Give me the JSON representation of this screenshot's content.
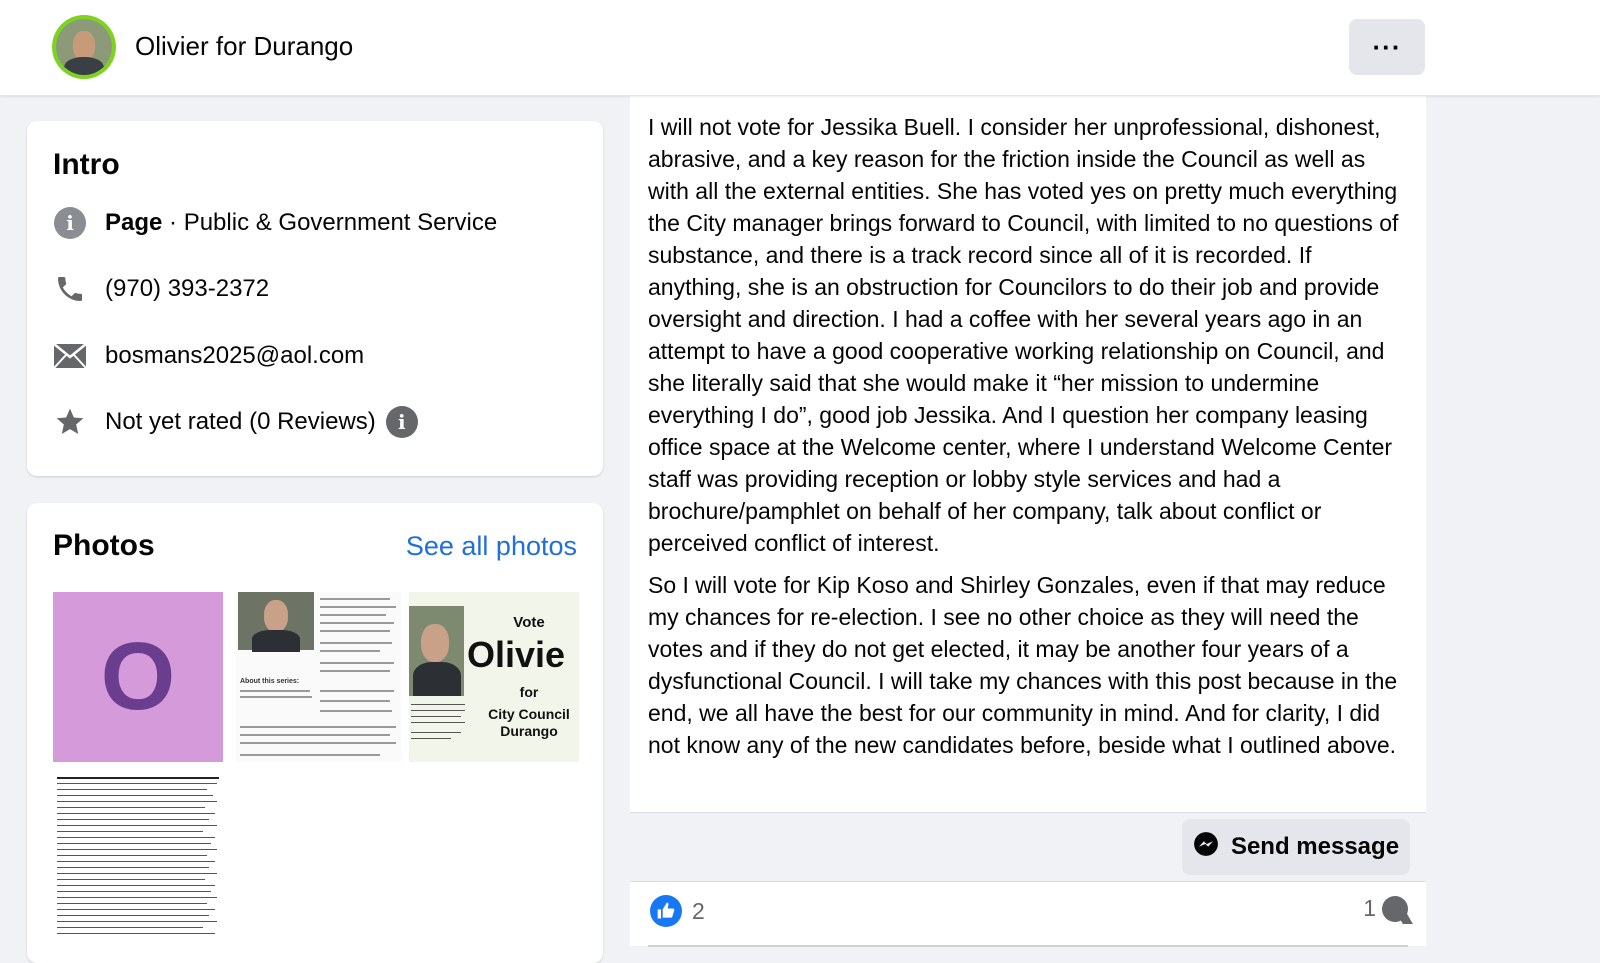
{
  "header": {
    "page_name": "Olivier for Durango",
    "more_label": "···"
  },
  "intro": {
    "title": "Intro",
    "category_bold": "Page",
    "category_rest": " · Public & Government Service",
    "phone": "(970) 393-2372",
    "email": "bosmans2025@aol.com",
    "rating": "Not yet rated (0 Reviews)",
    "info_glyph": "i"
  },
  "photos": {
    "title": "Photos",
    "see_all": "See all photos",
    "thumb_letter": "O",
    "vote_flyer": {
      "vote": "Vote",
      "name": "Olivie",
      "for": "for",
      "line1": "City Council",
      "line2": "Durango"
    },
    "news_heading": "About this series:"
  },
  "post": {
    "paragraph1": "I will not vote for Jessika Buell. I consider her unprofessional, dishonest, abrasive, and a key reason for the friction inside the Council as well as with all the external entities. She has voted yes on pretty much everything the City manager brings forward to Council, with limited to no questions of substance, and there is a track record since all of it is recorded. If anything, she is an obstruction for Councilors to do their job and provide oversight and direction. I had a coffee with her several years ago in an attempt to have a good cooperative working relationship on Council, and she literally said that she would make it “her mission to undermine everything I do”, good job Jessika. And I question her company leasing office space at the Welcome center, where I understand Welcome Center staff was providing reception or lobby style services and had a brochure/pamphlet on behalf of her company, talk about conflict or perceived conflict of interest.",
    "paragraph2": "So I will vote for Kip Koso and Shirley Gonzales, even if that may reduce my chances for re-election. I see no other choice as they will need the votes and if they do not get elected, it may be another four years of a dysfunctional Council. I will take my chances with this post because in the end, we all have the best for our community in mind. And for clarity, I did not know any of the new candidates before, beside what I outlined above.",
    "send_message": "Send message",
    "like_count": "2",
    "comment_count": "1"
  },
  "colors": {
    "link": "#216fdb",
    "like_blue": "#1877f2",
    "avatar_ring": "#7ed321",
    "thumb_purple": "#d49ad9"
  },
  "icons": [
    "info-icon",
    "phone-icon",
    "envelope-icon",
    "star-icon",
    "messenger-icon",
    "like-icon",
    "comment-icon",
    "more-icon"
  ]
}
